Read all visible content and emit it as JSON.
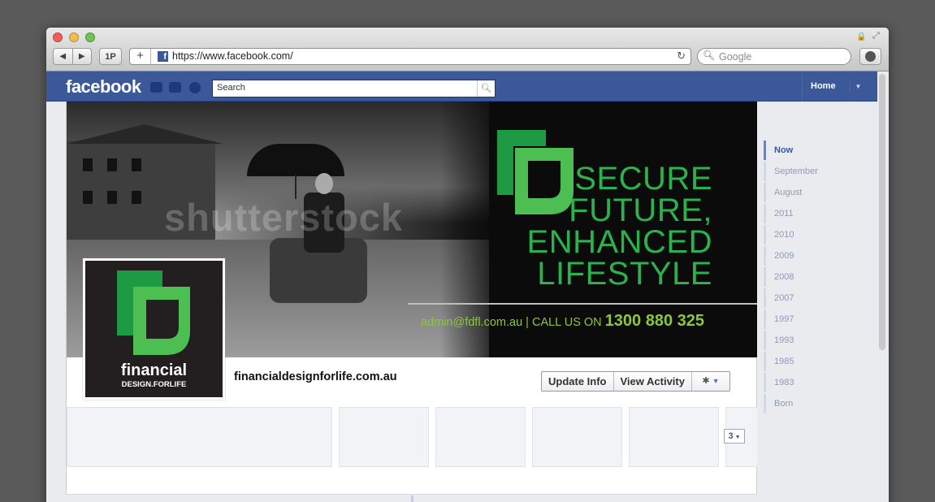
{
  "browser": {
    "url": "https://www.facebook.com/",
    "search_placeholder": "Google",
    "onepass_label": "1P",
    "new_tab_label": "+",
    "back_label": "◀",
    "forward_label": "▶",
    "reload_icon": "↻"
  },
  "facebook": {
    "logo": "facebook",
    "search_placeholder": "Search",
    "home_label": "Home"
  },
  "cover": {
    "watermark": "shutterstock",
    "tagline": [
      "SECURE",
      "FUTURE,",
      "ENHANCED",
      "LIFESTYLE"
    ],
    "contact_email": "admin@fdfl.com.au",
    "contact_call": "| CALL US ON",
    "contact_phone": "1300 880 325"
  },
  "profile": {
    "logo_word": "financial",
    "logo_sub": "DESIGN.FORLIFE",
    "page_name": "financialdesignforlife.com.au"
  },
  "actions": {
    "update_info": "Update Info",
    "view_activity": "View Activity"
  },
  "more_count": "3",
  "scrubber": [
    "Now",
    "September",
    "August",
    "2011",
    "2010",
    "2009",
    "2008",
    "2007",
    "1997",
    "1993",
    "1985",
    "1983",
    "Born"
  ],
  "colors": {
    "facebook_blue": "#3b5998",
    "brand_green": "#2bb24c",
    "brand_light_green": "#8dc63f"
  }
}
